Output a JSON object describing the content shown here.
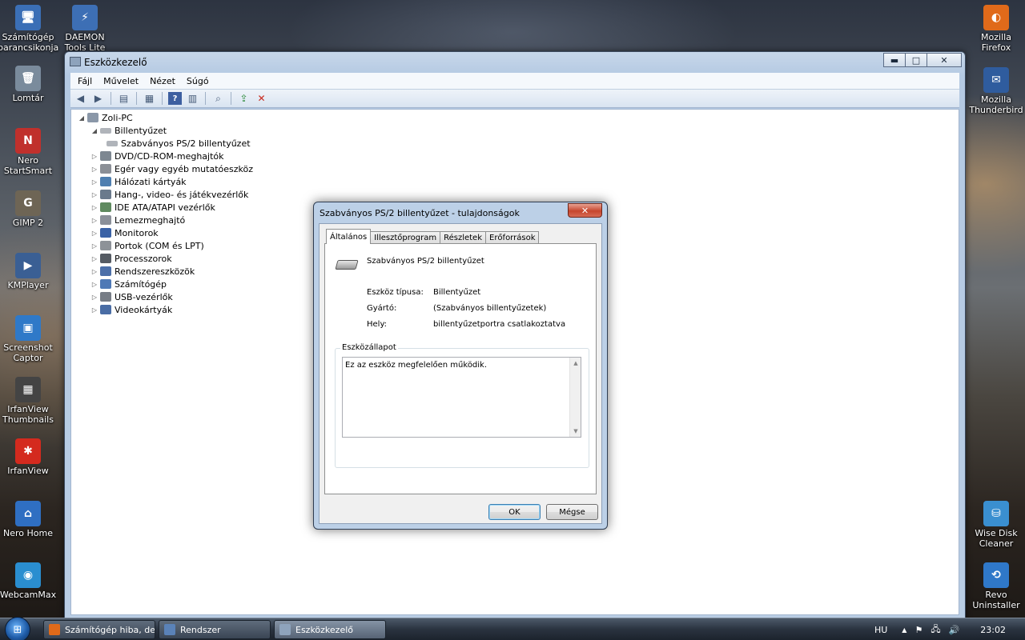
{
  "desktop": {
    "left_icons": [
      {
        "label": "Számítógép parancsikonja",
        "color": "#3b6fb6"
      },
      {
        "label": "Lomtár",
        "color": "#7a8b9c"
      },
      {
        "label": "Nero StartSmart",
        "color": "#c0302c"
      },
      {
        "label": "GIMP 2",
        "color": "#6e6555"
      },
      {
        "label": "KMPlayer",
        "color": "#3a5f94"
      },
      {
        "label": "Screenshot Captor",
        "color": "#2f79c8"
      },
      {
        "label": "IrfanView Thumbnails",
        "color": "#444444"
      },
      {
        "label": "IrfanView",
        "color": "#d42a1e"
      },
      {
        "label": "Nero Home",
        "color": "#2f6fc2"
      },
      {
        "label": "WebcamMax",
        "color": "#2a8ed0"
      }
    ],
    "top_icons": [
      {
        "label": "DAEMON Tools Lite",
        "color": "#3d6fb5"
      }
    ],
    "right_icons": [
      {
        "label": "Mozilla Firefox",
        "color": "#e06a1a"
      },
      {
        "label": "Mozilla Thunderbird",
        "color": "#2f5c9e"
      },
      {
        "label": "Wise Disk Cleaner",
        "color": "#3a8fd0"
      },
      {
        "label": "Revo Uninstaller",
        "color": "#2f78c9"
      }
    ]
  },
  "device_manager": {
    "title": "Eszközkezelő",
    "caption": {
      "minimize": "▬",
      "maximize": "□",
      "close": "✕"
    },
    "menu": [
      "Fájl",
      "Művelet",
      "Nézet",
      "Súgó"
    ],
    "toolbar_icons": [
      "back-arrow-icon",
      "forward-arrow-icon",
      "show-hide-tree-icon",
      "properties-icon",
      "help-icon",
      "view-icon",
      "scan-hardware-icon",
      "update-driver-icon",
      "uninstall-icon"
    ],
    "tree": {
      "root": "Zoli-PC",
      "expanded_category": "Billentyűzet",
      "expanded_child": "Szabványos PS/2 billentyűzet",
      "categories": [
        "DVD/CD-ROM-meghajtók",
        "Egér vagy egyéb mutatóeszköz",
        "Hálózati kártyák",
        "Hang-, video- és játékvezérlők",
        "IDE ATA/ATAPI vezérlők",
        "Lemezmeghajtó",
        "Monitorok",
        "Portok (COM és LPT)",
        "Processzorok",
        "Rendszereszközök",
        "Számítógép",
        "USB-vezérlők",
        "Videokártyák"
      ]
    }
  },
  "properties_dialog": {
    "title": "Szabványos PS/2 billentyűzet - tulajdonságok",
    "close": "✕",
    "tabs": [
      "Általános",
      "Illesztőprogram",
      "Részletek",
      "Erőforrások"
    ],
    "active_tab": "Általános",
    "device_name": "Szabványos PS/2 billentyűzet",
    "props": [
      {
        "label": "Eszköz típusa:",
        "value": "Billentyűzet"
      },
      {
        "label": "Gyártó:",
        "value": "(Szabványos billentyűzetek)"
      },
      {
        "label": "Hely:",
        "value": "billentyűzetportra csatlakoztatva"
      }
    ],
    "status_legend": "Eszközállapot",
    "status_text": "Ez az eszköz megfelelően működik.",
    "ok_label": "OK",
    "cancel_label": "Mégse"
  },
  "taskbar": {
    "start_glyph": "⊞",
    "buttons": [
      {
        "label": "Számítógép hiba, de ...",
        "color": "#e06a1a"
      },
      {
        "label": "Rendszer",
        "color": "#5a82b8"
      },
      {
        "label": "Eszközkezelő",
        "color": "#8ea3bc"
      }
    ],
    "language": "HU",
    "tray_icons": [
      "▲",
      "⚑",
      "🖧",
      "🔊"
    ],
    "clock": "23:02"
  }
}
